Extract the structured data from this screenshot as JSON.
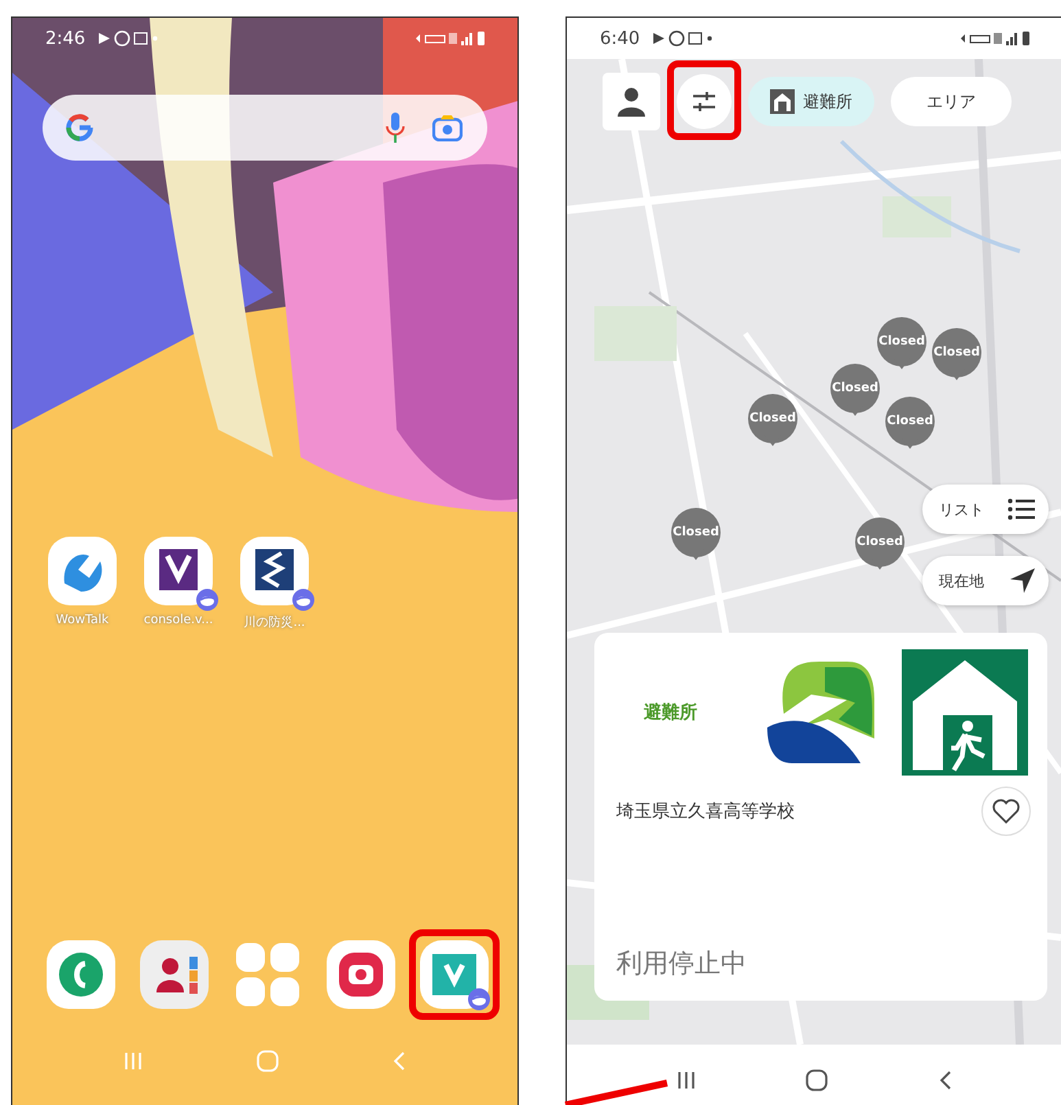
{
  "home_screen": {
    "status_bar": {
      "time": "2:46"
    },
    "apps": [
      {
        "label": "WowTalk",
        "kind": "wowtalk",
        "badge": false
      },
      {
        "label": "console.v...",
        "kind": "console",
        "badge": true
      },
      {
        "label": "川の防災...",
        "kind": "river",
        "badge": true
      }
    ],
    "dock": [
      {
        "kind": "phone",
        "badge": false,
        "highlighted": false
      },
      {
        "kind": "contacts",
        "badge": false,
        "highlighted": false
      },
      {
        "kind": "apps",
        "badge": false,
        "highlighted": false
      },
      {
        "kind": "camera",
        "badge": false,
        "highlighted": false
      },
      {
        "kind": "vapp",
        "badge": true,
        "highlighted": true
      }
    ]
  },
  "map_screen": {
    "status_bar": {
      "time": "6:40"
    },
    "filter_button": {
      "highlighted": true
    },
    "chips": [
      {
        "label": "避難所",
        "selected": true
      },
      {
        "label": "エリア",
        "selected": false
      }
    ],
    "markers": [
      {
        "label": "Closed"
      },
      {
        "label": "Closed"
      },
      {
        "label": "Closed"
      },
      {
        "label": "Closed"
      },
      {
        "label": "Closed"
      },
      {
        "label": "Closed"
      },
      {
        "label": "Closed"
      }
    ],
    "map_buttons": [
      {
        "label": "リスト",
        "kind": "list"
      },
      {
        "label": "現在地",
        "kind": "locate"
      }
    ],
    "card": {
      "category": "避難所",
      "name": "埼玉県立久喜高等学校",
      "status": "利用停止中",
      "favorite": false
    }
  }
}
